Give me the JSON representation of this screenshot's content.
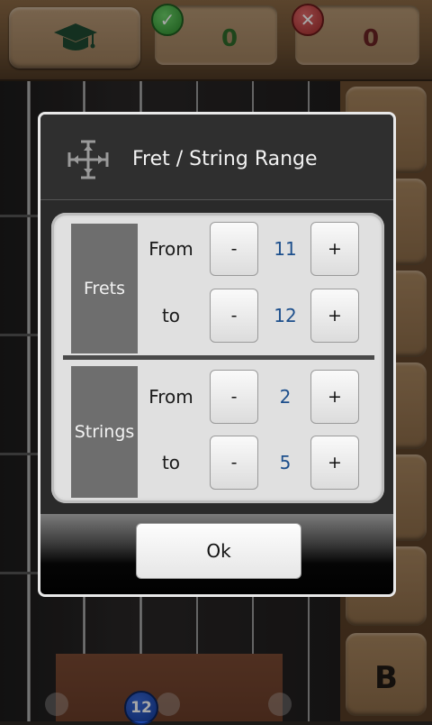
{
  "scores": {
    "correct": "0",
    "wrong": "0"
  },
  "side_keys": {
    "last_label": "B"
  },
  "fretboard": {
    "marker_label": "12"
  },
  "dialog": {
    "title": "Fret / String Range",
    "frets": {
      "label": "Frets",
      "from_label": "From",
      "from_value": "11",
      "to_label": "to",
      "to_value": "12"
    },
    "strings": {
      "label": "Strings",
      "from_label": "From",
      "from_value": "2",
      "to_label": "to",
      "to_value": "5"
    },
    "minus_label": "-",
    "plus_label": "+",
    "ok_label": "Ok"
  },
  "icons": {
    "learn": "graduation-cap-icon",
    "correct": "check-icon",
    "wrong": "cross-icon",
    "range": "move-arrows-icon"
  },
  "colors": {
    "value_text": "#1d4f8c",
    "correct_score": "#2f6a2a",
    "wrong_score": "#6a2424"
  }
}
